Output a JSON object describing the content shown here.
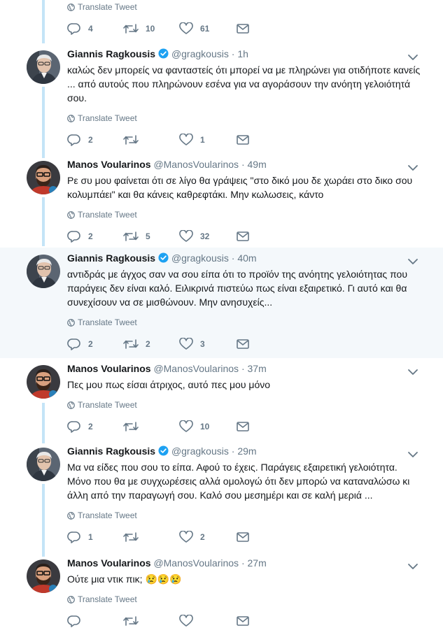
{
  "translate_label": "Translate Tweet",
  "colors": {
    "accent": "#1da1f2",
    "thread_line": "#c4e4f7",
    "highlight_bg": "#f4f8fb",
    "icon_gray": "#657786"
  },
  "top_actions": {
    "reply": "4",
    "retweet": "10",
    "like": "61"
  },
  "tweets": [
    {
      "name": "Giannis Ragkousis",
      "handle": "@gragkousis",
      "time": "1h",
      "verified": true,
      "text": "καλώς δεν μπορείς να φανταστείς ότι μπορεί να με πληρώνει για οτιδήποτε κανείς ... από αυτούς που πληρώνουν εσένα για να αγοράσουν την ανόητη γελοιότητά σου.",
      "reply": "2",
      "retweet": "",
      "like": "1"
    },
    {
      "name": "Manos Voularinos",
      "handle": "@ManosVoularinos",
      "time": "49m",
      "verified": false,
      "text": "Ρε συ μου φαίνεται ότι σε λίγο θα γράψεις \"στο δικό μου δε χωράει στο δικο σου κολυμπάει\" και θα κάνεις καθρεφτάκι. Μην κωλωσεις, κάντο",
      "reply": "2",
      "retweet": "5",
      "like": "32"
    },
    {
      "name": "Giannis Ragkousis",
      "handle": "@gragkousis",
      "time": "40m",
      "verified": true,
      "text": "αντιδράς με άγχος σαν να σου είπα ότι το προϊόν της ανόητης γελοιότητας που παράγεις δεν είναι καλό. Ειλικρινά πιστεύω πως είναι εξαιρετικό. Γι αυτό και θα συνεχίσουν να σε μισθώνουν. Μην ανησυχείς...",
      "reply": "2",
      "retweet": "2",
      "like": "3"
    },
    {
      "name": "Manos Voularinos",
      "handle": "@ManosVoularinos",
      "time": "37m",
      "verified": false,
      "text": "Πες μου πως είσαι άτριχος, αυτό πες μου μόνο",
      "reply": "2",
      "retweet": "",
      "like": "10"
    },
    {
      "name": "Giannis Ragkousis",
      "handle": "@gragkousis",
      "time": "29m",
      "verified": true,
      "text": "Μα να είδες που σου το είπα. Αφού το έχεις. Παράγεις εξαιρετική γελοιότητα. Μόνο που θα με συγχωρέσεις αλλά ομολογώ ότι δεν μπορώ να καταναλώσω κι άλλη από την παραγωγή σου. Καλό σου μεσημέρι και σε καλή μεριά ...",
      "reply": "1",
      "retweet": "",
      "like": "2"
    },
    {
      "name": "Manos Voularinos",
      "handle": "@ManosVoularinos",
      "time": "27m",
      "verified": false,
      "text": "Ούτε μια ντικ πικ; 😢😢😢",
      "reply": "",
      "retweet": "",
      "like": ""
    }
  ]
}
